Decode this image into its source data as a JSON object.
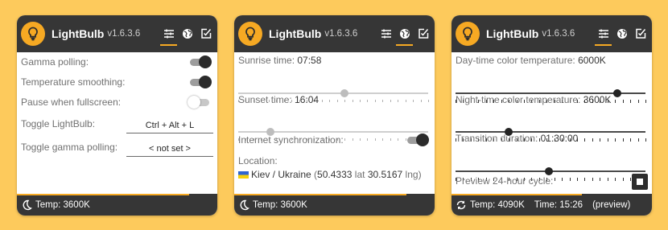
{
  "app": {
    "title": "LightBulb",
    "version": "v1.6.3.6"
  },
  "panels": [
    {
      "active_tab": "settings-tab",
      "gamma_polling": {
        "label": "Gamma polling:",
        "enabled": true
      },
      "temperature_smoothing": {
        "label": "Temperature smoothing:",
        "enabled": true
      },
      "pause_fullscreen": {
        "label": "Pause when fullscreen:",
        "enabled": false
      },
      "toggle_lightbulb": {
        "label": "Toggle LightBulb:",
        "hotkey": "Ctrl + Alt + L"
      },
      "toggle_gamma": {
        "label": "Toggle gamma polling:",
        "hotkey": "< not set >"
      },
      "footer": {
        "icon": "moon-icon",
        "temp_text": "Temp: 3600K",
        "cycle_progress": 0.86
      }
    },
    {
      "active_tab": "geo-tab",
      "sunrise": {
        "label": "Sunrise time:",
        "value": "07:58",
        "slider_fraction": 0.56
      },
      "sunset": {
        "label": "Sunset time:",
        "value": "16:04",
        "slider_fraction": 0.17
      },
      "internet_sync": {
        "label": "Internet synchronization:",
        "enabled": true
      },
      "location": {
        "label": "Location:",
        "flag": "ukraine-flag",
        "place": "Kiev / Ukraine",
        "lat_value": "50.4333",
        "lat_unit": "lat",
        "lng_value": "30.5167",
        "lng_unit": "lng"
      },
      "footer": {
        "icon": "moon-icon",
        "temp_text": "Temp: 3600K",
        "cycle_progress": 0.86
      }
    },
    {
      "active_tab": "advanced-tab",
      "day_temp": {
        "label": "Day-time color temperature:",
        "value": "6000K",
        "slider_fraction": 0.85
      },
      "night_temp": {
        "label": "Night-time color temperature:",
        "value": "3600K",
        "slider_fraction": 0.28
      },
      "transition": {
        "label": "Transition duration:",
        "value": "01:30:00",
        "slider_fraction": 0.49
      },
      "preview": {
        "label": "Preview 24-hour cycle:"
      },
      "footer": {
        "icon": "sync-icon",
        "temp_text": "Temp: 4090K",
        "time_text": "Time: 15:26",
        "preview_text": "(preview)",
        "cycle_progress": 0.65
      }
    }
  ],
  "colors": {
    "accent": "#f6a923",
    "header": "#363636",
    "background": "#fdca5c"
  }
}
